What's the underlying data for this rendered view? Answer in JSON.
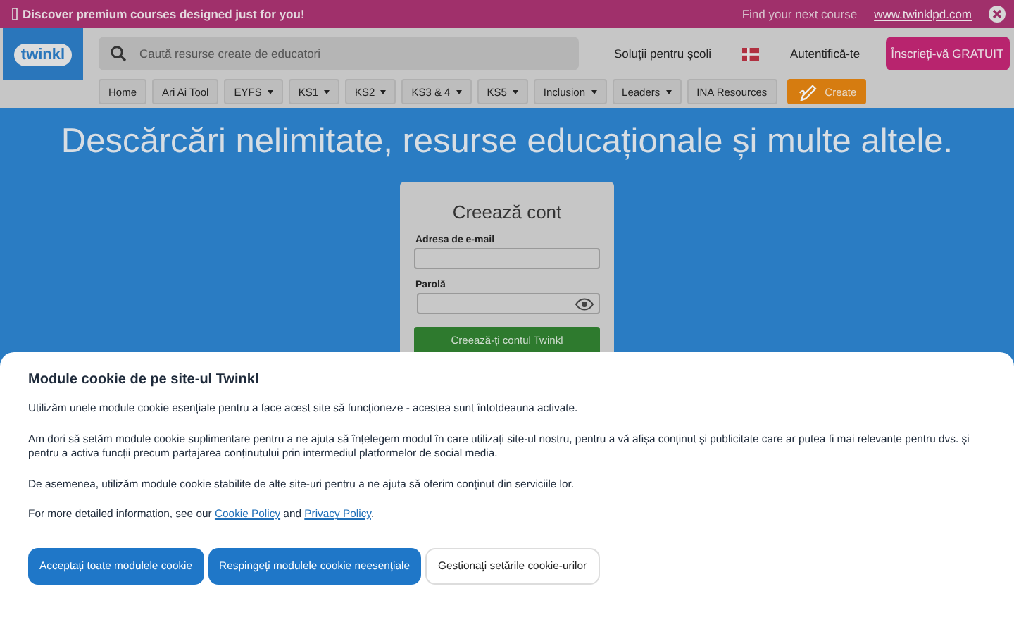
{
  "promo_banner": {
    "text": "Discover premium courses designed just for you!",
    "cta_text": "Find your next course",
    "link": "www.twinklpd.com"
  },
  "header": {
    "logo": "twinkl",
    "search": {
      "placeholder": "Caută resurse create de educatori"
    },
    "schools_link": "Soluții pentru școli",
    "login": "Autentifică-te",
    "register": "Înscrieți-vă GRATUIT"
  },
  "nav": [
    {
      "label": "Home",
      "dropdown": false
    },
    {
      "label": "Ari Ai Tool",
      "dropdown": false
    },
    {
      "label": "EYFS",
      "dropdown": true
    },
    {
      "label": "KS1",
      "dropdown": true
    },
    {
      "label": "KS2",
      "dropdown": true
    },
    {
      "label": "KS3 & 4",
      "dropdown": true
    },
    {
      "label": "KS5",
      "dropdown": true
    },
    {
      "label": "Inclusion",
      "dropdown": true
    },
    {
      "label": "Leaders",
      "dropdown": true
    },
    {
      "label": "INA Resources",
      "dropdown": false
    },
    {
      "label": "Create",
      "dropdown": false,
      "kind": "create"
    }
  ],
  "hero": {
    "title": "Descărcări nelimitate, resurse educaționale și multe altele."
  },
  "signup_card": {
    "title": "Creează cont",
    "email_label": "Adresa de e-mail",
    "password_label": "Parolă",
    "submit": "Creează-ți contul Twinkl"
  },
  "cookie_panel": {
    "title": "Module cookie de pe site-ul Twinkl",
    "paragraphs": [
      "Utilizăm unele module cookie esențiale pentru a face acest site să funcționeze - acestea sunt întotdeauna activate.",
      "Am dori să setăm module cookie suplimentare pentru a ne ajuta să înțelegem modul în care utilizați site-ul nostru, pentru a vă afișa conținut și publicitate care ar putea fi mai relevante pentru dvs. și pentru a activa funcții precum partajarea conținutului prin intermediul platformelor de social media.",
      "De asemenea, utilizăm module cookie stabilite de alte site-uri pentru a ne ajuta să oferim conținut din serviciile lor."
    ],
    "links_sentence": {
      "before": "For more detailed information, see our",
      "link1": "Cookie Policy",
      "middle": "and",
      "link2": "Privacy Policy",
      "after": "."
    },
    "buttons": [
      {
        "label": "Acceptați toate modulele cookie",
        "kind": "primary"
      },
      {
        "label": "Respingeți modulele cookie neesențiale",
        "kind": "primary"
      },
      {
        "label": "Gestionați setările cookie-urilor",
        "kind": "outline"
      }
    ]
  }
}
